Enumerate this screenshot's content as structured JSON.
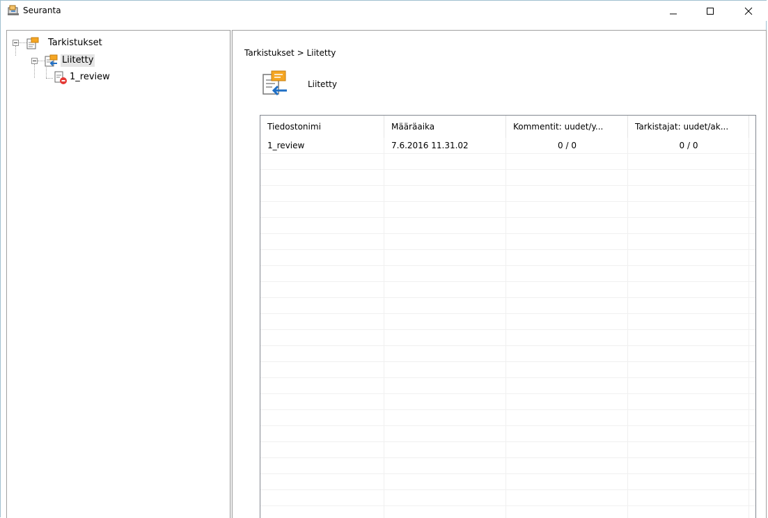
{
  "window": {
    "title": "Seuranta"
  },
  "titlebar": {
    "minimize_icon": "minimize-icon",
    "maximize_icon": "maximize-icon",
    "close_icon": "close-icon"
  },
  "tree": {
    "root": {
      "label": "Tarkistukset",
      "icon": "review-folder-icon"
    },
    "child": {
      "label": "Liitetty",
      "icon": "attached-review-icon"
    },
    "leaf": {
      "label": "1_review",
      "icon": "review-document-error-icon"
    }
  },
  "breadcrumb": "Tarkistukset > Liitetty",
  "header": {
    "title": "Liitetty",
    "icon": "attached-review-large-icon"
  },
  "table": {
    "columns": [
      "Tiedostonimi",
      "Määräaika",
      "Kommentit: uudet/y...",
      "Tarkistajat: uudet/ak..."
    ],
    "rows": [
      [
        "1_review",
        "7.6.2016 11.31.02",
        "0 / 0",
        "0 / 0"
      ]
    ]
  },
  "colors": {
    "window_border": "#9fbfcf",
    "selected_background": "#e5e5e5",
    "accent_orange": "#f5a623",
    "accent_blue": "#1f6fc5",
    "error_red": "#e53935"
  }
}
